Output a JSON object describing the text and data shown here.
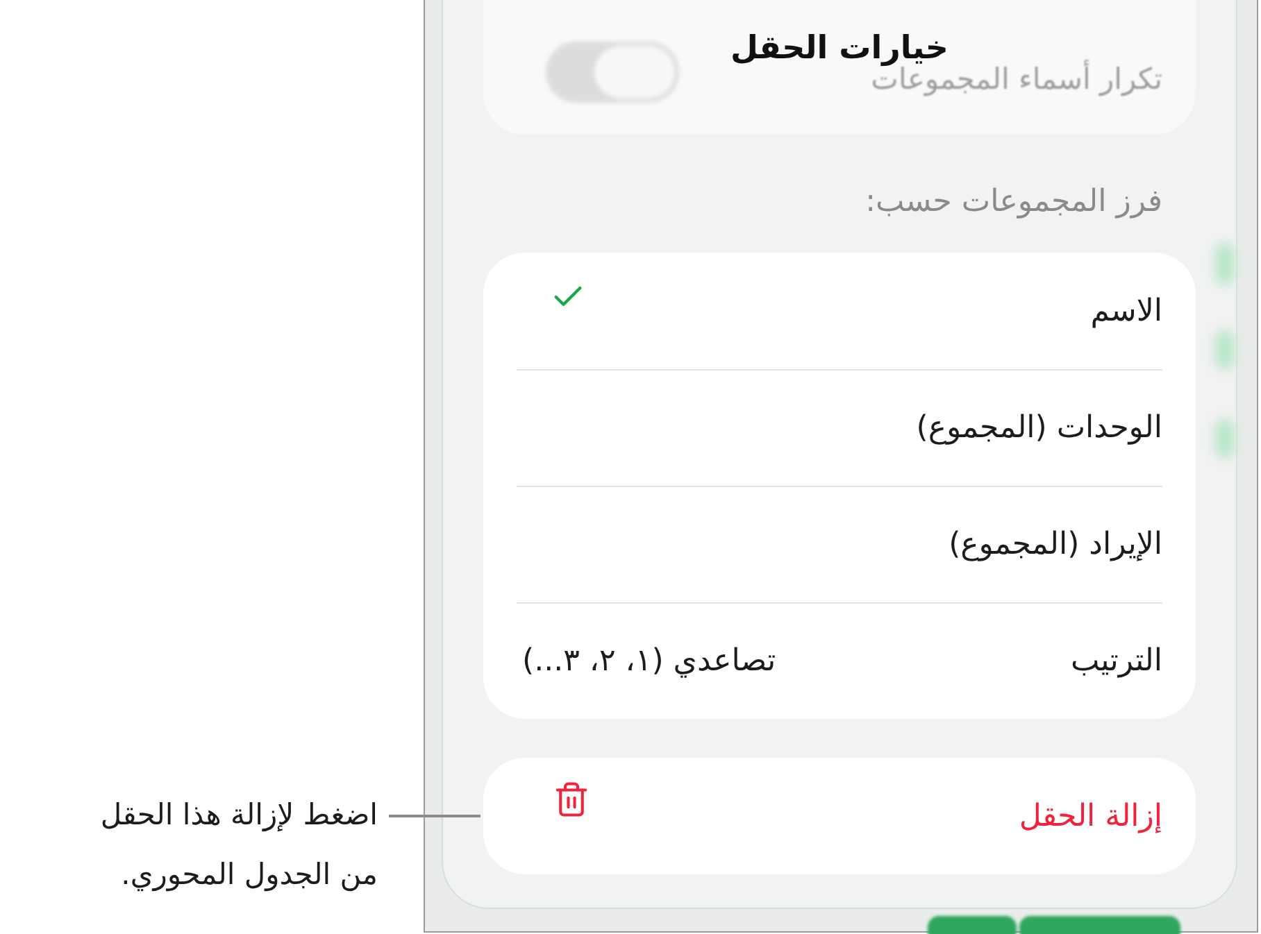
{
  "header": {
    "title": "خيارات الحقل"
  },
  "group_names_card": {
    "label": "تكرار أسماء المجموعات",
    "toggle": {
      "on": false
    }
  },
  "sort_section": {
    "heading": "فرز المجموعات حسب:",
    "options": [
      {
        "kind": "option",
        "label": "الاسم",
        "selected": true
      },
      {
        "kind": "option",
        "label": "الوحدات (المجموع)",
        "selected": false
      },
      {
        "kind": "option",
        "label": "الإيراد (المجموع)",
        "selected": false
      },
      {
        "kind": "value",
        "label": "الترتيب",
        "value": "تصاعدي (١، ٢، ٣...)"
      }
    ]
  },
  "remove_button": {
    "label": "إزالة الحقل"
  },
  "callout": {
    "text": "اضغط لإزالة هذا الحقل من الجدول المحوري."
  }
}
